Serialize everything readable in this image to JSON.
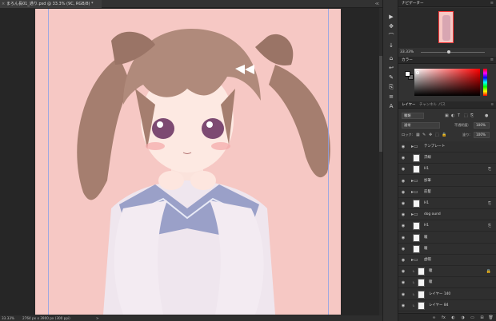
{
  "document": {
    "tab_title": "まろん長01_通り.psd @ 33.3% (9C, RGB/8) *",
    "close_symbol": "×",
    "scroll_arrows": "≪",
    "zoom": "33.33%",
    "doc_info": "2764 px x 3900 px (300 ppi)",
    "status_arrow": ">"
  },
  "tools": {
    "items": [
      "▶",
      "✥",
      "⌒",
      "↓",
      "⌂",
      "↩",
      "✎",
      "⎘",
      "≡",
      "A"
    ]
  },
  "navigator": {
    "title": "ナビゲーター",
    "menu": "≡",
    "zoom": "33.33%"
  },
  "color_panel": {
    "title": "カラー",
    "menu": "≡",
    "fg_color": "#ffffff",
    "bg_color": "#6b6b6b"
  },
  "layers_panel": {
    "tabs": [
      "レイヤー",
      "チャンネル",
      "パス"
    ],
    "menu": "≡",
    "filter_kind": "種類",
    "blend_mode": "通常",
    "opacity_label": "不透明度:",
    "opacity_value": "100%",
    "lock_label": "ロック:",
    "fill_label": "塗り:",
    "fill_value": "100%",
    "filter_icons": [
      "▣",
      "◐",
      "T",
      "⬚",
      "⎘",
      "●"
    ],
    "lock_icons": [
      "▦",
      "✎",
      "✥",
      "⬚",
      "🔒"
    ],
    "layers": [
      {
        "name": "テンプレート",
        "kind": "folder",
        "indent": 0,
        "visible": true,
        "tag": ""
      },
      {
        "name": "浮線",
        "kind": "layer",
        "indent": 0,
        "visible": true,
        "tag": ""
      },
      {
        "name": "H1",
        "kind": "layer",
        "indent": 0,
        "visible": true,
        "tag": "⎘"
      },
      {
        "name": "加筆",
        "kind": "folder",
        "indent": 0,
        "visible": true,
        "tag": ""
      },
      {
        "name": "前髪",
        "kind": "folder",
        "indent": 0,
        "visible": true,
        "tag": ""
      },
      {
        "name": "H1",
        "kind": "layer",
        "indent": 0,
        "visible": true,
        "tag": "⎘"
      },
      {
        "name": "dog ound",
        "kind": "folder",
        "indent": 0,
        "visible": true,
        "tag": ""
      },
      {
        "name": "H1",
        "kind": "layer",
        "indent": 0,
        "visible": true,
        "tag": "⎘"
      },
      {
        "name": "瞳",
        "kind": "layer",
        "indent": 0,
        "visible": true,
        "tag": ""
      },
      {
        "name": "瞳",
        "kind": "layer",
        "indent": 0,
        "visible": true,
        "tag": ""
      },
      {
        "name": "虚帽",
        "kind": "folder",
        "indent": 0,
        "visible": true,
        "tag": ""
      },
      {
        "name": "瞳",
        "kind": "layer",
        "indent": 1,
        "visible": true,
        "tag": "🔒"
      },
      {
        "name": "瞳",
        "kind": "layer",
        "indent": 1,
        "visible": true,
        "tag": ""
      },
      {
        "name": "レイヤー 140",
        "kind": "layer",
        "indent": 1,
        "visible": true,
        "tag": ""
      },
      {
        "name": "レイヤー 84",
        "kind": "layer",
        "indent": 1,
        "visible": true,
        "tag": ""
      }
    ],
    "footer_icons": [
      "∞",
      "fx",
      "◐",
      "◑",
      "▭",
      "⊞",
      "🗑"
    ]
  }
}
